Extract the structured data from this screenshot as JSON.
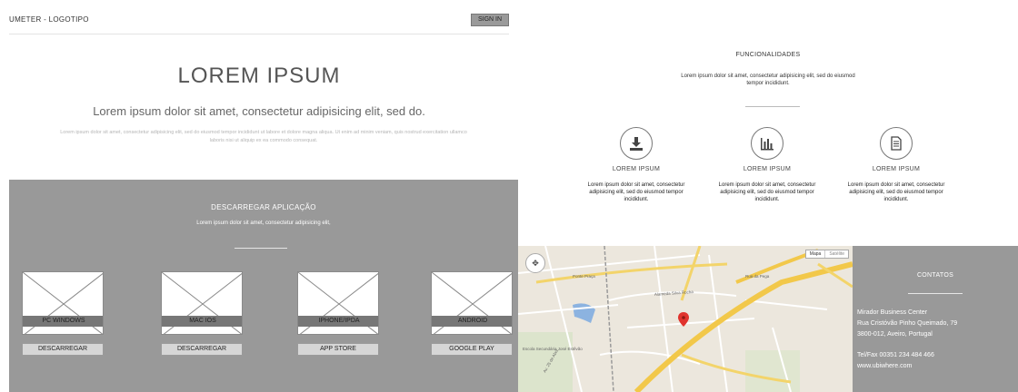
{
  "header": {
    "logo": "UMETER - LOGOTIPO",
    "signin_label": "SIGN IN"
  },
  "hero": {
    "title": "LOREM IPSUM",
    "subtitle": "Lorem ipsum dolor sit amet, consectetur adipisicing elit, sed do.",
    "body": "Lorem ipsum dolor sit amet, consectetur adipisicing elit, sed do eiusmod tempor incididunt ut labore et dolore magna aliqua. Ut enim ad minim veniam, quis nostrud exercitation ullamco laboris nisi ut aliquip ex ea commodo consequat."
  },
  "download": {
    "title": "DESCARREGAR APLICAÇÃO",
    "subtitle": "Lorem ipsum dolor sit amet, consectetur adipisicing elit,",
    "platforms": [
      {
        "label": "PC WINDOWS",
        "button": "DESCARREGAR"
      },
      {
        "label": "MAC IOS",
        "button": "DESCARREGAR"
      },
      {
        "label": "IPHONE/IPDA",
        "button": "APP STORE"
      },
      {
        "label": "ANDROID",
        "button": "GOOGLE PLAY"
      }
    ]
  },
  "features": {
    "title": "FUNCIONALIDADES",
    "subtitle": "Lorem ipsum dolor sit amet, consectetur adipisicing elit, sed do eiusmod tempor incididunt.",
    "items": [
      {
        "icon": "download-icon",
        "title": "LOREM IPSUM",
        "desc": "Lorem ipsum dolor sit amet, consectetur adipisicing elit, sed do eiusmod tempor incididunt."
      },
      {
        "icon": "bar-chart-icon",
        "title": "LOREM IPSUM",
        "desc": "Lorem ipsum dolor sit amet, consectetur adipisicing elit, sed do eiusmod tempor incididunt."
      },
      {
        "icon": "document-icon",
        "title": "LOREM IPSUM",
        "desc": "Lorem ipsum dolor sit amet, consectetur adipisicing elit, sed do eiusmod tempor incididunt."
      }
    ]
  },
  "map": {
    "mode_map": "Mapa",
    "mode_satellite": "Satélite",
    "streets": [
      "Alameda Silva Rocha",
      "Rua da Pega",
      "Ponte Praça",
      "Av. 25 de Abril",
      "Escola Secundária José Estêvão"
    ]
  },
  "contacts": {
    "title": "CONTATOS",
    "address": [
      "Mirador Business Center",
      "Rua Cristóvão Pinho Queimado, 79",
      "3800-012, Aveiro, Portugal"
    ],
    "tel": "Tel/Fax 00351 234 484 466",
    "website": "www.ubiwhere.com"
  }
}
